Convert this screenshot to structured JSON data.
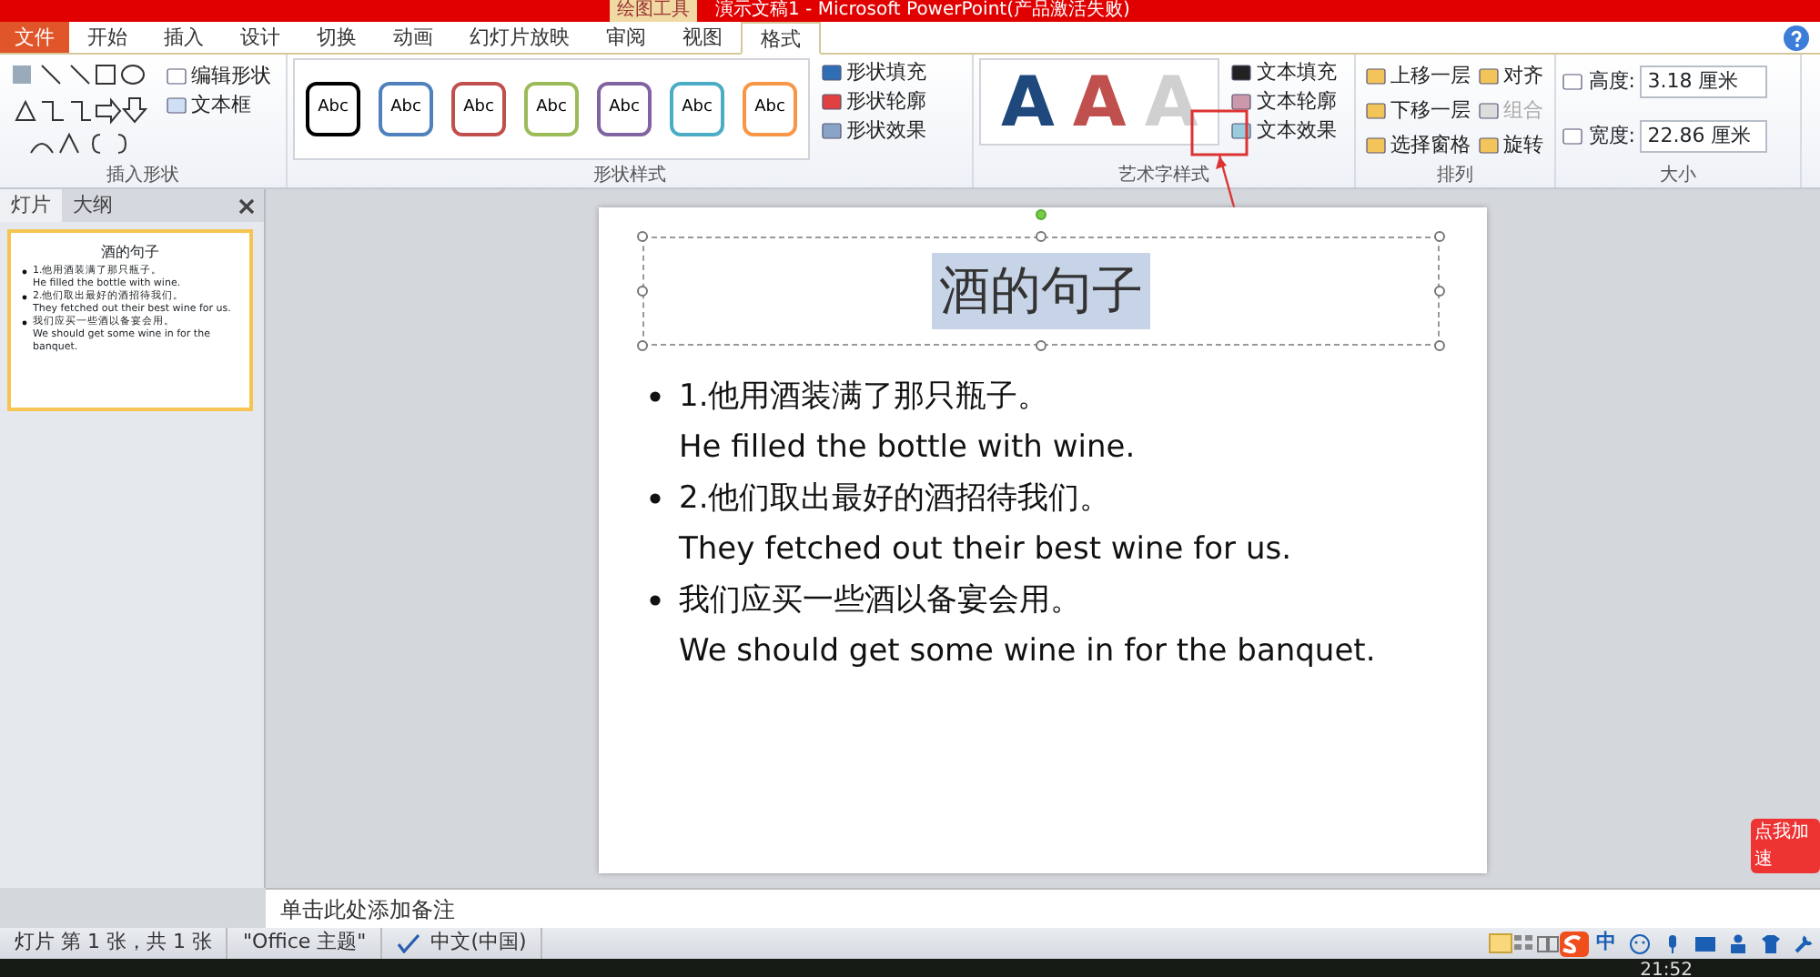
{
  "title_bar": {
    "context_tab": "绘图工具",
    "title": "演示文稿1 - Microsoft PowerPoint(产品激活失败)"
  },
  "tabs": [
    {
      "label": "文件",
      "kind": "file",
      "selected": false
    },
    {
      "label": "开始",
      "kind": "tab",
      "selected": false
    },
    {
      "label": "插入",
      "kind": "tab",
      "selected": false
    },
    {
      "label": "设计",
      "kind": "tab",
      "selected": false
    },
    {
      "label": "切换",
      "kind": "tab",
      "selected": false
    },
    {
      "label": "动画",
      "kind": "tab",
      "selected": false
    },
    {
      "label": "幻灯片放映",
      "kind": "tab",
      "selected": false
    },
    {
      "label": "审阅",
      "kind": "tab",
      "selected": false
    },
    {
      "label": "视图",
      "kind": "tab",
      "selected": false
    },
    {
      "label": "格式",
      "kind": "tab",
      "selected": true
    }
  ],
  "insert_shapes": {
    "commands": [
      "编辑形状",
      "文本框"
    ],
    "label": "插入形状"
  },
  "shape_styles": {
    "swatches": [
      {
        "label": "Abc",
        "color": "#000000"
      },
      {
        "label": "Abc",
        "color": "#4f81bd"
      },
      {
        "label": "Abc",
        "color": "#c0504d"
      },
      {
        "label": "Abc",
        "color": "#9bbb59"
      },
      {
        "label": "Abc",
        "color": "#8064a2"
      },
      {
        "label": "Abc",
        "color": "#4bacc6"
      },
      {
        "label": "Abc",
        "color": "#f79646"
      }
    ],
    "commands": [
      "形状填充",
      "形状轮廓",
      "形状效果"
    ],
    "label": "形状样式"
  },
  "wordart_styles": {
    "letters": [
      {
        "label": "A",
        "color": "#1f497d"
      },
      {
        "label": "A",
        "color": "#c0504d"
      },
      {
        "label": "A",
        "color": "#d0d0d0"
      }
    ],
    "commands": [
      "文本填充",
      "文本轮廓",
      "文本效果"
    ],
    "label": "艺术字样式"
  },
  "arrange": {
    "commands": [
      {
        "label": "上移一层",
        "disabled": false
      },
      {
        "label": "对齐",
        "disabled": false
      },
      {
        "label": "下移一层",
        "disabled": false
      },
      {
        "label": "组合",
        "disabled": true
      },
      {
        "label": "选择窗格",
        "disabled": false
      },
      {
        "label": "旋转",
        "disabled": false
      }
    ],
    "label": "排列"
  },
  "size": {
    "fields": [
      {
        "label": "高度:",
        "value": "3.18 厘米"
      },
      {
        "label": "宽度:",
        "value": "22.86 厘米"
      }
    ],
    "label": "大小"
  },
  "side_pane": {
    "tabs": [
      {
        "label": "灯片",
        "selected": true
      },
      {
        "label": "大纲",
        "selected": false
      }
    ],
    "thumbnail": {
      "title": "酒的句子",
      "bullets": [
        {
          "lines": [
            "1.他用酒装满了那只瓶子。",
            "He filled the bottle with wine."
          ]
        },
        {
          "lines": [
            "2.他们取出最好的酒招待我们。",
            "They fetched out their best wine for us."
          ]
        },
        {
          "lines": [
            "我们应买一些酒以备宴会用。",
            "We should get some wine in for the banquet."
          ]
        }
      ]
    }
  },
  "slide": {
    "title": "酒的句子",
    "title_selected": true,
    "bullets": [
      {
        "lines": [
          "1.他用酒装满了那只瓶子。",
          "He filled the bottle with wine."
        ]
      },
      {
        "lines": [
          "2.他们取出最好的酒招待我们。",
          "They fetched out their best wine for us."
        ]
      },
      {
        "lines": [
          "我们应买一些酒以备宴会用。",
          "We should get some wine in for the banquet."
        ]
      }
    ]
  },
  "notes": {
    "placeholder": "单击此处添加备注"
  },
  "status_bar": {
    "items": [
      "灯片 第 1 张，共 1 张",
      "\"Office 主题\"",
      "中文(中国)"
    ],
    "ime": "中"
  },
  "sticker": {
    "label": "点我加速"
  },
  "taskbar": {
    "time": "21:52"
  }
}
